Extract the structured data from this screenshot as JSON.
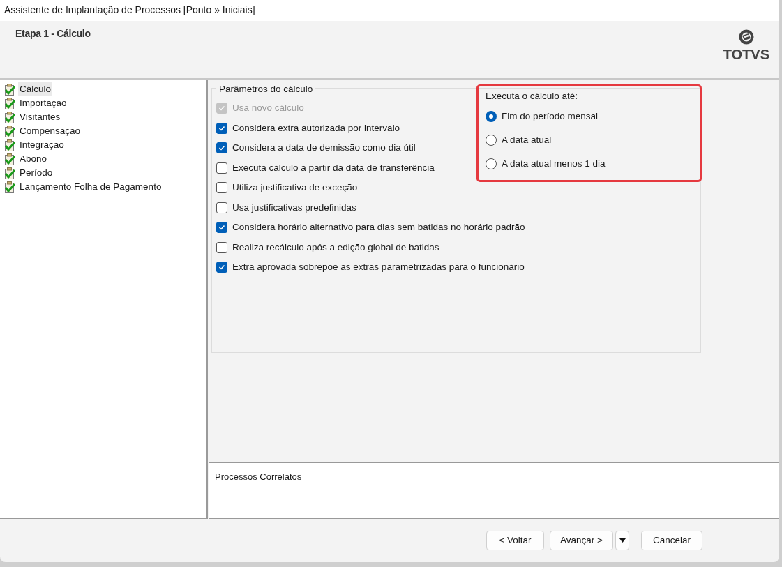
{
  "window": {
    "title": "Assistente de Implantação de Processos [Ponto » Iniciais]"
  },
  "header": {
    "step_title": "Etapa 1 - Cálculo",
    "logo_text": "TOTVS"
  },
  "steps": [
    {
      "label": "Cálculo",
      "selected": true
    },
    {
      "label": "Importação",
      "selected": false
    },
    {
      "label": "Visitantes",
      "selected": false
    },
    {
      "label": "Compensação",
      "selected": false
    },
    {
      "label": "Integração",
      "selected": false
    },
    {
      "label": "Abono",
      "selected": false
    },
    {
      "label": "Período",
      "selected": false
    },
    {
      "label": "Lançamento Folha de Pagamento",
      "selected": false
    }
  ],
  "parameters": {
    "title": "Parâmetros do cálculo",
    "options": [
      {
        "label": "Usa novo cálculo",
        "checked": true,
        "disabled": true
      },
      {
        "label": "Considera extra autorizada por intervalo",
        "checked": true,
        "disabled": false
      },
      {
        "label": "Considera a data de demissão como dia útil",
        "checked": true,
        "disabled": false
      },
      {
        "label": "Executa cálculo a partir da data de transferência",
        "checked": false,
        "disabled": false
      },
      {
        "label": "Utiliza justificativa de exceção",
        "checked": false,
        "disabled": false
      },
      {
        "label": "Usa justificativas predefinidas",
        "checked": false,
        "disabled": false
      },
      {
        "label": "Considera horário alternativo para dias sem batidas no horário padrão",
        "checked": true,
        "disabled": false
      },
      {
        "label": "Realiza recálculo após a edição global de batidas",
        "checked": false,
        "disabled": false
      },
      {
        "label": "Extra aprovada sobrepõe as extras parametrizadas para o funcionário",
        "checked": true,
        "disabled": false
      }
    ]
  },
  "calc_until": {
    "title": "Executa o cálculo até:",
    "highlighted": true,
    "options": [
      {
        "label": "Fim do período mensal",
        "selected": true
      },
      {
        "label": "A data atual",
        "selected": false
      },
      {
        "label": "A data atual menos 1 dia",
        "selected": false
      }
    ]
  },
  "related": {
    "title": "Processos Correlatos"
  },
  "buttons": [
    {
      "label": "< Voltar",
      "kind": "text"
    },
    {
      "label": "Avançar >",
      "kind": "text"
    },
    {
      "kind": "dropdown"
    },
    {
      "label": "Cancelar",
      "kind": "text"
    }
  ]
}
